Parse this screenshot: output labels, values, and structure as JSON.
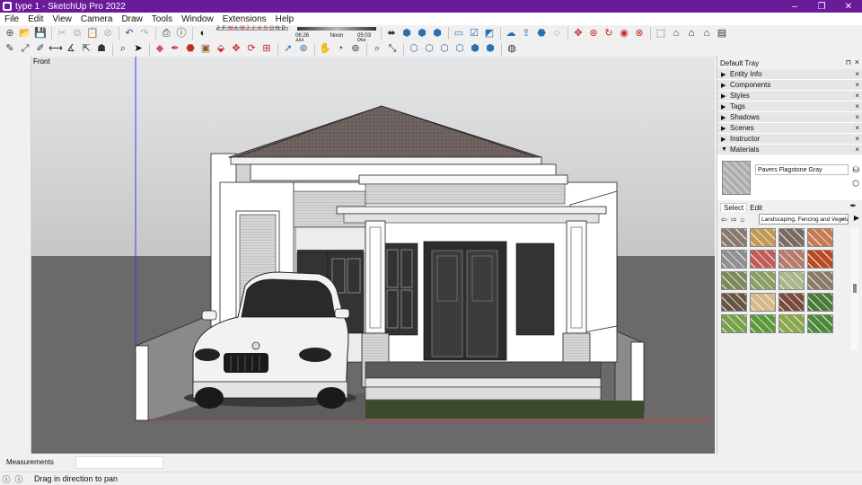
{
  "window": {
    "title": "type 1 - SketchUp Pro 2022",
    "controls": {
      "minimize": "–",
      "maximize": "❐",
      "close": "✕"
    }
  },
  "menu": [
    "File",
    "Edit",
    "View",
    "Camera",
    "Draw",
    "Tools",
    "Window",
    "Extensions",
    "Help"
  ],
  "shadows": {
    "months": [
      "J",
      "F",
      "M",
      "A",
      "M",
      "J",
      "J",
      "A",
      "S",
      "O",
      "N",
      "D"
    ],
    "time_start": "06:26 AM",
    "time_mid": "Noon",
    "time_end": "05:03 PM"
  },
  "toolbar1": [
    {
      "name": "new-icon",
      "glyph": "⊕",
      "color": "#555"
    },
    {
      "name": "open-icon",
      "glyph": "📂",
      "color": "#555"
    },
    {
      "name": "save-icon",
      "glyph": "💾",
      "color": "#1f5fa8"
    },
    {
      "name": "cut-icon",
      "glyph": "✂",
      "color": "#aaa"
    },
    {
      "name": "copy-icon",
      "glyph": "⧉",
      "color": "#aaa"
    },
    {
      "name": "paste-icon",
      "glyph": "📋",
      "color": "#aaa"
    },
    {
      "name": "erase-icon",
      "glyph": "⊘",
      "color": "#aaa"
    },
    {
      "name": "undo-icon",
      "glyph": "↶",
      "color": "#1f5fa8"
    },
    {
      "name": "redo-icon",
      "glyph": "↷",
      "color": "#aaa"
    },
    {
      "name": "print-icon",
      "glyph": "⎙",
      "color": "#333"
    },
    {
      "name": "model-info-icon",
      "glyph": "ⓘ",
      "color": "#333"
    },
    {
      "name": "shadow-toggle-icon",
      "glyph": "◐",
      "color": "#222"
    }
  ],
  "toolbar1_right": [
    {
      "name": "position-camera-icon",
      "glyph": "⬌",
      "color": "#333"
    },
    {
      "name": "iso-view-icon",
      "glyph": "⬢",
      "color": "#2a6fb0"
    },
    {
      "name": "top-view-icon",
      "glyph": "⬢",
      "color": "#2a6fb0"
    },
    {
      "name": "front-view-icon",
      "glyph": "⬢",
      "color": "#2a6fb0"
    },
    {
      "name": "section-plane-icon",
      "glyph": "▭",
      "color": "#2a6fb0"
    },
    {
      "name": "section-display-icon",
      "glyph": "☑",
      "color": "#2a6fb0"
    },
    {
      "name": "section-cut-icon",
      "glyph": "◩",
      "color": "#2a6fb0"
    },
    {
      "name": "warehouse-icon",
      "glyph": "☁",
      "color": "#2a6fb0"
    },
    {
      "name": "share-model-icon",
      "glyph": "⇪",
      "color": "#2a6fb0"
    },
    {
      "name": "extension-warehouse-icon",
      "glyph": "⬣",
      "color": "#2a6fb0"
    },
    {
      "name": "extension-manager-icon",
      "glyph": "◌",
      "color": "#2a6fb0"
    },
    {
      "name": "move-red-icon",
      "glyph": "✥",
      "color": "#c62828"
    },
    {
      "name": "rotate-red-icon",
      "glyph": "⊛",
      "color": "#c62828"
    },
    {
      "name": "follow-me-red-icon",
      "glyph": "↻",
      "color": "#c62828"
    },
    {
      "name": "offset-red-icon",
      "glyph": "◉",
      "color": "#c62828"
    },
    {
      "name": "intersect-red-icon",
      "glyph": "⊗",
      "color": "#c62828"
    },
    {
      "name": "3d-text-icon",
      "glyph": "⬚",
      "color": "#333"
    },
    {
      "name": "component-icon",
      "glyph": "⌂",
      "color": "#333"
    },
    {
      "name": "house-icon",
      "glyph": "⌂",
      "color": "#000"
    },
    {
      "name": "house-outline-icon",
      "glyph": "⌂",
      "color": "#333"
    },
    {
      "name": "window-icon",
      "glyph": "▤",
      "color": "#333"
    }
  ],
  "toolbar2": [
    {
      "name": "line-icon",
      "glyph": "✎",
      "color": "#333"
    },
    {
      "name": "arc-icon",
      "glyph": "⤢",
      "color": "#333"
    },
    {
      "name": "pencil-icon",
      "glyph": "✐",
      "color": "#333"
    },
    {
      "name": "dimension-icon",
      "glyph": "⟷",
      "color": "#333"
    },
    {
      "name": "protractor-icon",
      "glyph": "∡",
      "color": "#333"
    },
    {
      "name": "axes-icon",
      "glyph": "⇱",
      "color": "#333"
    },
    {
      "name": "tape-icon",
      "glyph": "☗",
      "color": "#333"
    },
    {
      "name": "zoom-icon",
      "glyph": "⌕",
      "color": "#333"
    },
    {
      "name": "select-icon",
      "glyph": "➤",
      "color": "#000"
    },
    {
      "name": "eraser-icon",
      "glyph": "◆",
      "color": "#d34a8a"
    },
    {
      "name": "pen-icon",
      "glyph": "✒",
      "color": "#c62828"
    },
    {
      "name": "paint-icon",
      "glyph": "⬣",
      "color": "#c62828"
    },
    {
      "name": "shape-icon",
      "glyph": "▣",
      "color": "#8a5a2a"
    },
    {
      "name": "push-pull-icon",
      "glyph": "⬙",
      "color": "#c62828"
    },
    {
      "name": "move-icon",
      "glyph": "✥",
      "color": "#c62828"
    },
    {
      "name": "rotate-icon",
      "glyph": "⟳",
      "color": "#c62828"
    },
    {
      "name": "scale-icon",
      "glyph": "⊞",
      "color": "#c62828"
    },
    {
      "name": "follow-icon",
      "glyph": "➚",
      "color": "#2a6fb0"
    },
    {
      "name": "orbit-icon",
      "glyph": "⊛",
      "color": "#2a6fb0"
    },
    {
      "name": "pan-icon",
      "glyph": "✋",
      "color": "#8a5a2a"
    },
    {
      "name": "walk-icon",
      "glyph": "◔",
      "color": "#333"
    },
    {
      "name": "look-around-icon",
      "glyph": "⊚",
      "color": "#333"
    },
    {
      "name": "zoom-window-icon",
      "glyph": "⌕",
      "color": "#333"
    },
    {
      "name": "zoom-extents-icon",
      "glyph": "⤡",
      "color": "#333"
    },
    {
      "name": "xray-icon",
      "glyph": "⬡",
      "color": "#2a6fb0"
    },
    {
      "name": "wireframe-icon",
      "glyph": "⬡",
      "color": "#2a6fb0"
    },
    {
      "name": "hidden-line-icon",
      "glyph": "⬡",
      "color": "#2a6fb0"
    },
    {
      "name": "shaded-icon",
      "glyph": "⬡",
      "color": "#2a6fb0"
    },
    {
      "name": "textured-icon",
      "glyph": "⬢",
      "color": "#2a6fb0"
    },
    {
      "name": "monochrome-icon",
      "glyph": "⬢",
      "color": "#2a6fb0"
    },
    {
      "name": "styles-icon",
      "glyph": "◍",
      "color": "#333"
    }
  ],
  "viewport": {
    "label": "Front",
    "sky_color": "#c9c9c9",
    "ground_color": "#666666"
  },
  "tray": {
    "title": "Default Tray",
    "pin": "⊓",
    "close": "×",
    "panels": [
      {
        "label": "Entity Info",
        "expanded": false
      },
      {
        "label": "Components",
        "expanded": false
      },
      {
        "label": "Styles",
        "expanded": false
      },
      {
        "label": "Tags",
        "expanded": false
      },
      {
        "label": "Shadows",
        "expanded": false
      },
      {
        "label": "Scenes",
        "expanded": false
      },
      {
        "label": "Instructor",
        "expanded": false
      },
      {
        "label": "Materials",
        "expanded": true
      }
    ],
    "materials": {
      "name": "Pavers Flagstone Gray",
      "tab_select": "Select",
      "tab_edit": "Edit",
      "library": "Landscaping, Fencing and Vegetation",
      "swatches": [
        "#8a7a6e",
        "#c49a52",
        "#7a6a62",
        "#c87950",
        "#909090",
        "#c25a58",
        "#b87a6a",
        "#b84a20",
        "#7c8a5a",
        "#8aa062",
        "#a8b888",
        "#8a7a6a",
        "#6a5444",
        "#d8b88a",
        "#7a4a3a",
        "#4a7a3a",
        "#7aa04a",
        "#5a9a3a",
        "#8aa84a",
        "#4a8a3a"
      ]
    }
  },
  "measurements": {
    "label": "Measurements",
    "value": ""
  },
  "status": {
    "message": "Drag in direction to pan",
    "icons": [
      "ⓘ",
      "ⓘ"
    ]
  }
}
